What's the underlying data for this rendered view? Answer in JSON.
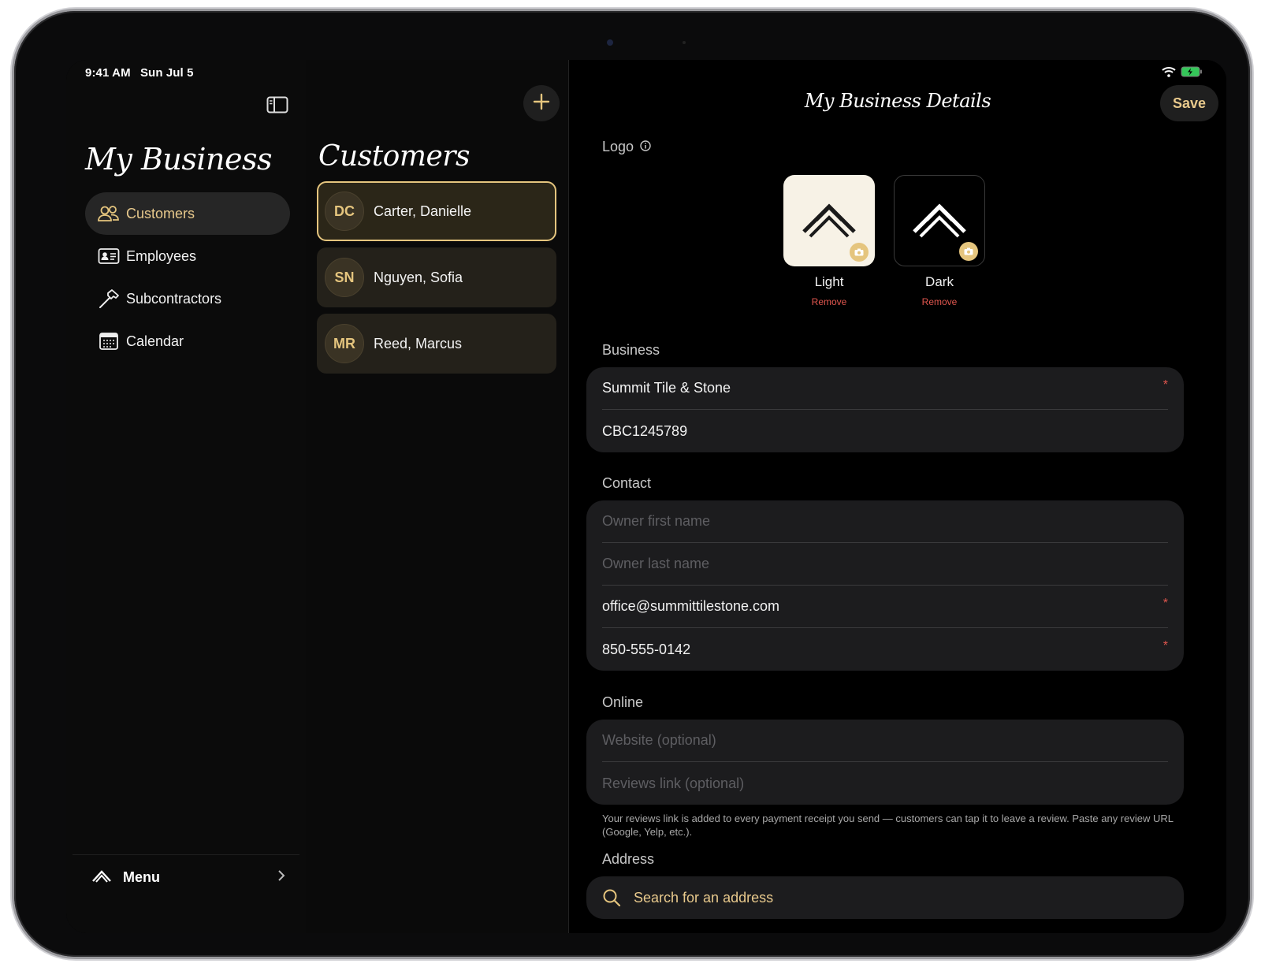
{
  "status_bar": {
    "time": "9:41 AM",
    "date": "Sun Jul 5"
  },
  "sidebar": {
    "title": "My Business",
    "items": [
      {
        "label": "Customers",
        "icon": "people-icon",
        "active": true
      },
      {
        "label": "Employees",
        "icon": "id-card-icon",
        "active": false
      },
      {
        "label": "Subcontractors",
        "icon": "hammer-icon",
        "active": false
      },
      {
        "label": "Calendar",
        "icon": "calendar-icon",
        "active": false
      }
    ],
    "footer_label": "Menu"
  },
  "customers": {
    "title": "Customers",
    "list": [
      {
        "initials": "DC",
        "name": "Carter, Danielle",
        "selected": true
      },
      {
        "initials": "SN",
        "name": "Nguyen, Sofia",
        "selected": false
      },
      {
        "initials": "MR",
        "name": "Reed, Marcus",
        "selected": false
      }
    ]
  },
  "detail": {
    "title": "My Business Details",
    "save_label": "Save",
    "logo": {
      "label": "Logo",
      "light_label": "Light",
      "dark_label": "Dark",
      "remove_label": "Remove"
    },
    "business": {
      "label": "Business",
      "name": "Summit Tile & Stone",
      "license": "CBC1245789"
    },
    "contact": {
      "label": "Contact",
      "first_name_placeholder": "Owner first name",
      "last_name_placeholder": "Owner last name",
      "email": "office@summittilestone.com",
      "phone": "850-555-0142"
    },
    "online": {
      "label": "Online",
      "website_placeholder": "Website (optional)",
      "reviews_placeholder": "Reviews link (optional)",
      "note": "Your reviews link is added to every payment receipt you send — customers can tap it to leave a review. Paste any review URL (Google, Yelp, etc.)."
    },
    "address": {
      "label": "Address",
      "search_placeholder": "Search for an address"
    },
    "required_mark": "*"
  },
  "colors": {
    "accent": "#e5c57e",
    "required": "#e0564e",
    "surface": "#1c1c1e"
  }
}
